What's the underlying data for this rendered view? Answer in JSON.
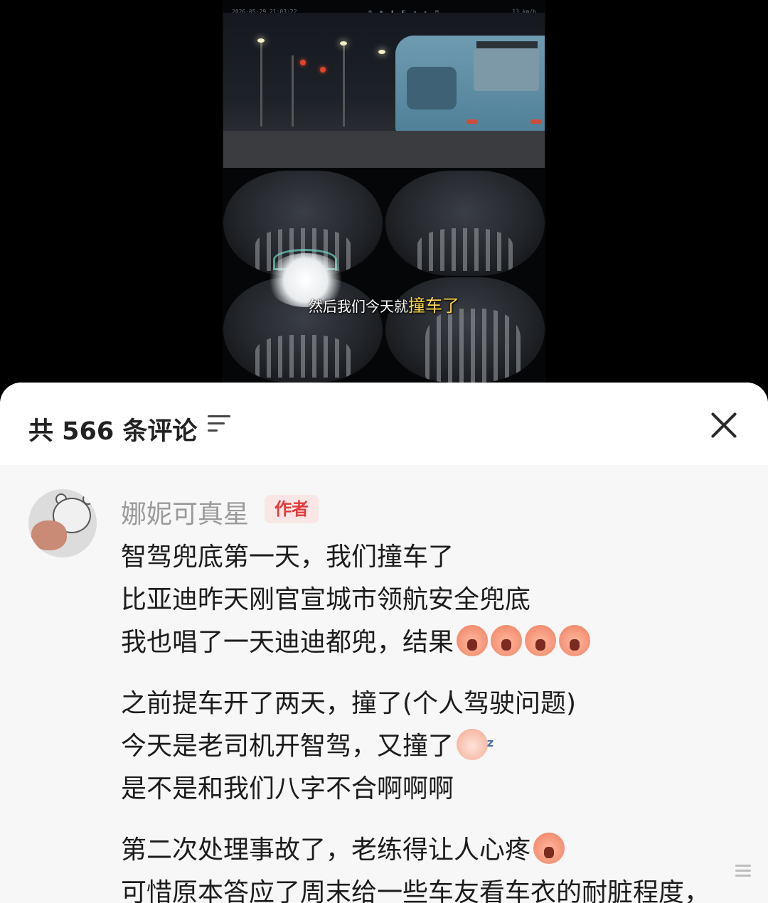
{
  "video": {
    "status_left": "2026-05-29 21:03:22",
    "status_right": "13 km/h",
    "subtitle_prefix": "然后我们今天就",
    "subtitle_highlight": "撞车了"
  },
  "comments_panel": {
    "count_label": "共 566 条评论"
  },
  "comment": {
    "username": "娜妮可真星",
    "author_tag": "作者",
    "paragraphs": [
      [
        "智驾兜底第一天，我们撞车了",
        "比亚迪昨天刚官宣城市领航安全兜底",
        "我也唱了一天迪迪都兜，结果"
      ],
      [
        "之前提车开了两天，撞了(个人驾驶问题)",
        "今天是老司机开智驾，又撞了",
        "是不是和我们八字不合啊啊啊"
      ],
      [
        "第二次处理事故了，老练得让人心疼",
        "可惜原本答应了周末给一些车友看车衣的耐脏程度，"
      ]
    ],
    "emojis": {
      "line3": [
        "crying-emoji",
        "crying-emoji",
        "crying-emoji",
        "crying-emoji"
      ],
      "line5": [
        "sleepy-emoji"
      ],
      "line7": [
        "crying-emoji"
      ]
    }
  }
}
